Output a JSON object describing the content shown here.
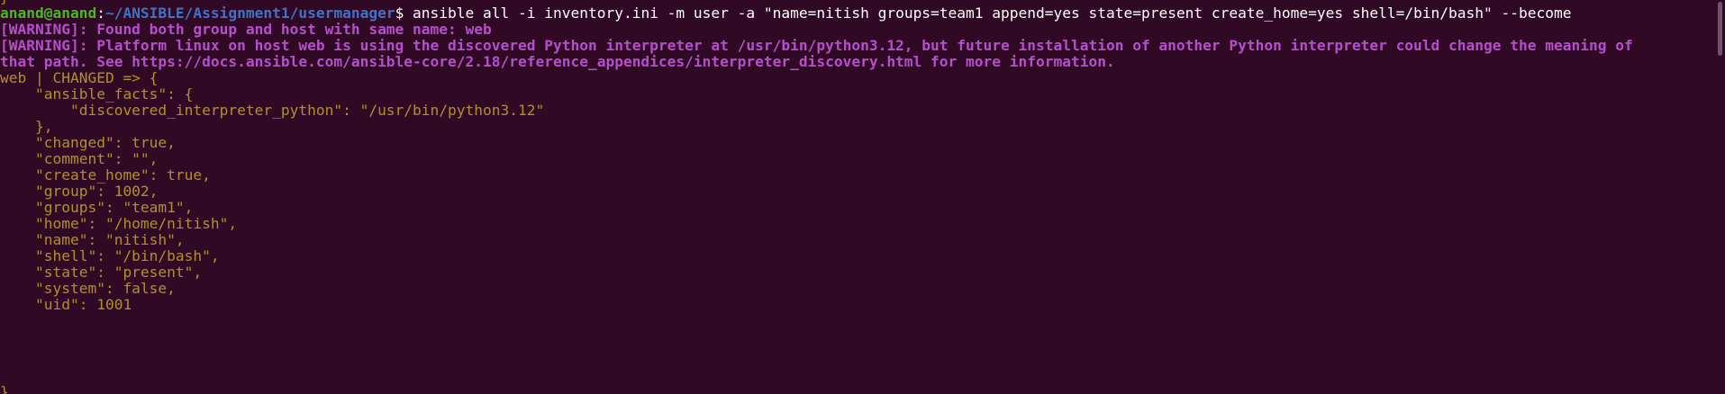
{
  "terminal": {
    "top_partial": "}",
    "prompt": {
      "user_host": "anand@anand",
      "separator": ":",
      "path": "~/ANSIBLE/Assignment1/usermanager",
      "symbol": "$",
      "command": " ansible all -i inventory.ini -m user -a \"name=nitish groups=team1 append=yes state=present create_home=yes shell=/bin/bash\" --become"
    },
    "warnings": [
      "[WARNING]: Found both group and host with same name: web",
      "[WARNING]: Platform linux on host web is using the discovered Python interpreter at /usr/bin/python3.12, but future installation of another Python interpreter could change the meaning of",
      "that path. See https://docs.ansible.com/ansible-core/2.18/reference_appendices/interpreter_discovery.html for more information."
    ],
    "output_lines": [
      "web | CHANGED => {",
      "    \"ansible_facts\": {",
      "        \"discovered_interpreter_python\": \"/usr/bin/python3.12\"",
      "    },",
      "    \"changed\": true,",
      "    \"comment\": \"\",",
      "    \"create_home\": true,",
      "    \"group\": 1002,",
      "    \"groups\": \"team1\",",
      "    \"home\": \"/home/nitish\",",
      "    \"name\": \"nitish\",",
      "    \"shell\": \"/bin/bash\",",
      "    \"state\": \"present\",",
      "    \"system\": false,",
      "    \"uid\": 1001"
    ],
    "bottom_partial": "}"
  },
  "colors": {
    "background": "#300a24",
    "prompt_user": "#4ab825",
    "prompt_path": "#3f73c9",
    "warning": "#b54fcd",
    "changed_output": "#b19029",
    "command_text": "#ffffff"
  }
}
